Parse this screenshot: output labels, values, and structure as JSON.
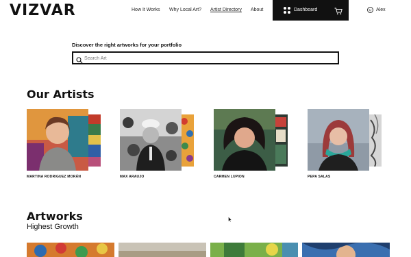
{
  "brand": {
    "logo": "VIZVAR"
  },
  "nav": {
    "items": [
      "How It Works",
      "Why Local Art?",
      "Artist Directory",
      "About"
    ],
    "dashboard_label": "Dashboard",
    "user_label": "Alex"
  },
  "search": {
    "heading": "Discover the right artworks for your portfolio",
    "placeholder": "Search Art"
  },
  "artists": {
    "title": "Our Artists",
    "items": [
      {
        "name": "MARTINA RODRIGUEZ MORÁN"
      },
      {
        "name": "MAX ARAUJO"
      },
      {
        "name": "CARMEN LUPION"
      },
      {
        "name": "PEPA SALAS"
      }
    ]
  },
  "artworks": {
    "title": "Artworks",
    "subtitle": "Highest Growth"
  },
  "icons": [
    "dashboard-grid-icon",
    "cart-icon",
    "user-smiley-icon",
    "search-icon",
    "mouse-cursor-icon"
  ],
  "colors": {
    "header_button_bg": "#111111",
    "text": "#111111",
    "background": "#ffffff"
  }
}
